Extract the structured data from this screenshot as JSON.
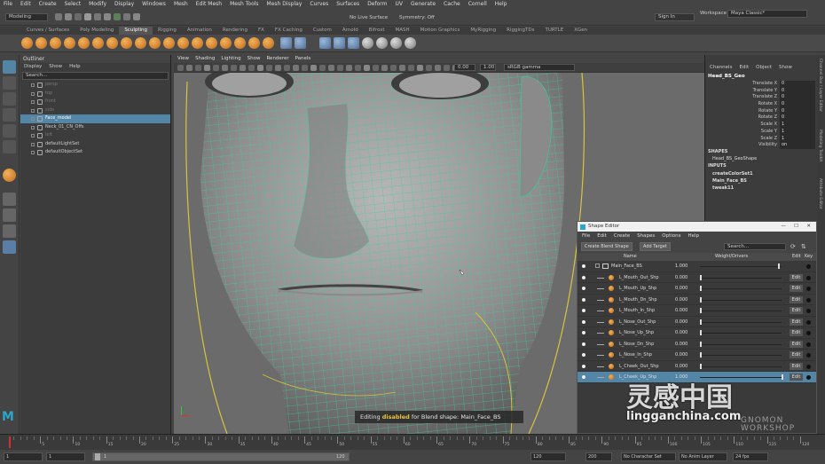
{
  "menubar": [
    "File",
    "Edit",
    "Create",
    "Select",
    "Modify",
    "Display",
    "Windows",
    "Mesh",
    "Edit Mesh",
    "Mesh Tools",
    "Mesh Display",
    "Curves",
    "Surfaces",
    "Deform",
    "UV",
    "Generate",
    "Cache",
    "Cornell",
    "Help"
  ],
  "statusline": {
    "mode": "Modeling",
    "live_surface": "No Live Surface",
    "symmetry": "Symmetry: Off",
    "sign_in": "Sign In",
    "workspace_label": "Workspace :",
    "workspace_value": "Maya Classic*"
  },
  "shelf_tabs": [
    "Curves / Surfaces",
    "Poly Modeling",
    "Sculpting",
    "Rigging",
    "Animation",
    "Rendering",
    "FX",
    "FX Caching",
    "Custom",
    "Arnold",
    "Bifrost",
    "MASH",
    "Motion Graphics",
    "MyRigging",
    "RiggingTDs",
    "TURTLE",
    "XGen"
  ],
  "shelf_active": "Sculpting",
  "outliner": {
    "title": "Outliner",
    "menu": [
      "Display",
      "Show",
      "Help"
    ],
    "search_placeholder": "Search...",
    "rows": [
      {
        "label": "persp",
        "dim": true
      },
      {
        "label": "top",
        "dim": true
      },
      {
        "label": "front",
        "dim": true
      },
      {
        "label": "side",
        "dim": true
      },
      {
        "label": "Face_model",
        "sel": true
      },
      {
        "label": "Neck_01_CN_Offs",
        "dim": false
      },
      {
        "label": "left",
        "dim": true
      },
      {
        "label": "defaultLightSet",
        "dim": false
      },
      {
        "label": "defaultObjectSet",
        "dim": false
      }
    ]
  },
  "viewport": {
    "menu": [
      "View",
      "Shading",
      "Lighting",
      "Show",
      "Renderer",
      "Panels"
    ],
    "exposure": "0.00",
    "gamma": "1.00",
    "colorspace": "sRGB gamma",
    "hud": {
      "prefix": "Editing ",
      "highlight": "disabled",
      "suffix": " for Blend shape: Main_Face_BS"
    }
  },
  "channel_box": {
    "menu": [
      "Channels",
      "Edit",
      "Object",
      "Show"
    ],
    "node": "Head_BS_Geo",
    "attrs": [
      {
        "name": "Translate X",
        "value": "0"
      },
      {
        "name": "Translate Y",
        "value": "0"
      },
      {
        "name": "Translate Z",
        "value": "0"
      },
      {
        "name": "Rotate X",
        "value": "0"
      },
      {
        "name": "Rotate Y",
        "value": "0"
      },
      {
        "name": "Rotate Z",
        "value": "0"
      },
      {
        "name": "Scale X",
        "value": "1"
      },
      {
        "name": "Scale Y",
        "value": "1"
      },
      {
        "name": "Scale Z",
        "value": "1"
      },
      {
        "name": "Visibility",
        "value": "on"
      }
    ],
    "shapes_label": "SHAPES",
    "shape_node": "Head_BS_GeoShape",
    "inputs_label": "INPUTS",
    "inputs": [
      "createColorSet1",
      "Main_Face_BS",
      "tweak11"
    ]
  },
  "side_tabs": [
    "Channel Box / Layer Editor",
    "Modeling Toolkit",
    "Attribute Editor"
  ],
  "shape_editor": {
    "title": "Shape Editor",
    "menu": [
      "File",
      "Edit",
      "Create",
      "Shapes",
      "Options",
      "Help"
    ],
    "create_btn": "Create Blend Shape",
    "add_btn": "Add Target",
    "search_placeholder": "Search...",
    "headers": {
      "name": "Name",
      "weight": "Weight/Drivers",
      "edit": "Edit",
      "key": "Key"
    },
    "group": {
      "name": "Main_Face_BS",
      "value": "1.000"
    },
    "rows": [
      {
        "name": "L_Mouth_Out_Shp",
        "value": "0.000"
      },
      {
        "name": "L_Mouth_Up_Shp",
        "value": "0.000"
      },
      {
        "name": "L_Mouth_Dn_Shp",
        "value": "0.000"
      },
      {
        "name": "L_Mouth_In_Shp",
        "value": "0.000"
      },
      {
        "name": "L_Nose_Out_Shp",
        "value": "0.000"
      },
      {
        "name": "L_Nose_Up_Shp",
        "value": "0.000"
      },
      {
        "name": "L_Nose_Dn_Shp",
        "value": "0.000"
      },
      {
        "name": "L_Nose_In_Shp",
        "value": "0.000"
      },
      {
        "name": "L_Cheek_Out_Shp",
        "value": "0.000"
      },
      {
        "name": "L_Cheek_Up_Shp",
        "value": "1.000",
        "sel": true
      }
    ],
    "edit_label": "Edit"
  },
  "timeline": {
    "ticks": [
      "5",
      "10",
      "15",
      "20",
      "25",
      "30",
      "35",
      "40",
      "45",
      "50",
      "55",
      "60",
      "65",
      "70",
      "75",
      "80",
      "85",
      "90",
      "95",
      "100",
      "105",
      "110",
      "115",
      "120"
    ]
  },
  "range": {
    "start": "1",
    "start2": "1",
    "mid": "1",
    "end": "120",
    "end2": "120",
    "max": "200",
    "character": "No Character Set",
    "anim_layer": "No Anim Layer",
    "fps": "24 fps"
  },
  "watermark": {
    "brand": "灵感中国",
    "url": "lingganchina.com",
    "right": "GNOMON WORKSHOP"
  },
  "colors": {
    "accent": "#5285a6",
    "wire": "#35d0a0",
    "hud_highlight": "#e8c43a",
    "curve": "#d8c43c"
  }
}
